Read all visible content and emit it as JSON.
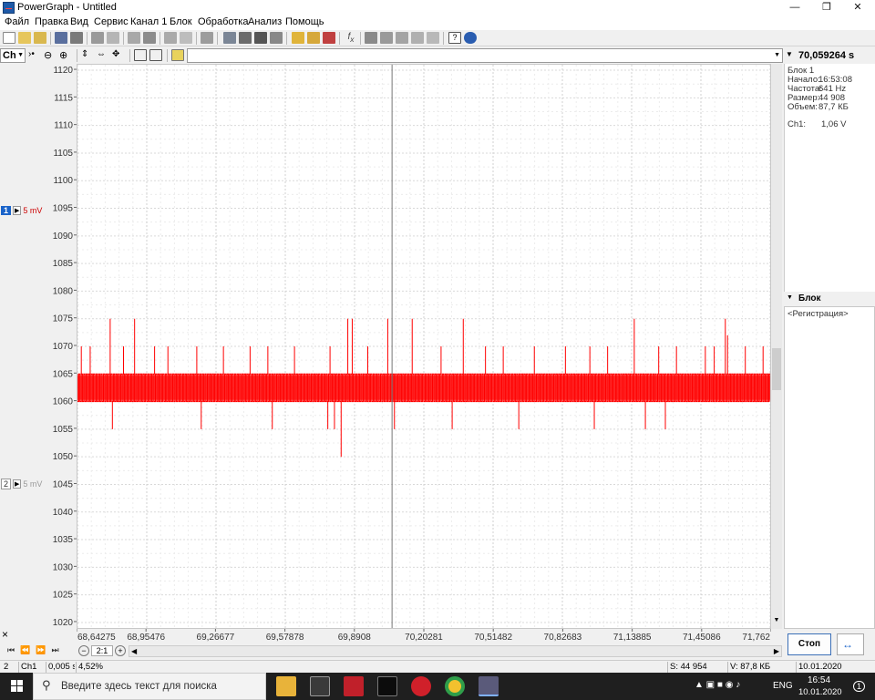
{
  "window": {
    "title": "PowerGraph - Untitled"
  },
  "menu": [
    "Файл",
    "Правка",
    "Вид",
    "Сервис",
    "Канал 1",
    "Блок",
    "Обработка",
    "Анализ",
    "Помощь"
  ],
  "toolbar2": {
    "channel_select": "Ch",
    "time_readout": "70,059264 s"
  },
  "channels": [
    {
      "number": "1",
      "scale": "5 mV",
      "color": "#cc0000",
      "active": true
    },
    {
      "number": "2",
      "scale": "5 mV",
      "color": "#9a9a9a",
      "active": false
    }
  ],
  "info_panel": {
    "block": "Блок 1",
    "start_label": "Начало:",
    "start_value": "16:53:08",
    "freq_label": "Частота:",
    "freq_value": "641 Hz",
    "size_label": "Размер:",
    "size_value": "44 908",
    "volume_label": "Объем:",
    "volume_value": "87,7 КБ",
    "ch1_label": "Ch1:",
    "ch1_value": "1,06 V"
  },
  "block_panel": {
    "header": "Блок",
    "item": "<Регистрация>"
  },
  "controls": {
    "close_glyph": "×",
    "zoom_ratio": "2:1",
    "stop_label": "Стоп"
  },
  "status": {
    "index": "2",
    "channel": "Ch1",
    "dt": "0,005 s",
    "percent": "4,52%",
    "samples": "S: 44 954",
    "volume": "V: 87,8 КБ",
    "date": "10.01.2020"
  },
  "taskbar": {
    "search_placeholder": "Введите здесь текст для поиска",
    "lang": "ENG",
    "time": "16:54",
    "date": "10.01.2020",
    "notifications": "1"
  },
  "chart_data": {
    "type": "line",
    "y_ticks": [
      1120,
      1115,
      1110,
      1105,
      1100,
      1095,
      1090,
      1085,
      1080,
      1075,
      1070,
      1065,
      1060,
      1055,
      1050,
      1045,
      1040,
      1035,
      1030,
      1025,
      1020
    ],
    "ylim": [
      1019,
      1121
    ],
    "x_ticks": [
      "68,64275",
      "68,95476",
      "69,26677",
      "69,57878",
      "69,8908",
      "70,20281",
      "70,51482",
      "70,82683",
      "71,13885",
      "71,45086",
      "71,762"
    ],
    "xlim": [
      68.64275,
      71.762
    ],
    "cursor_x": 70.059264,
    "grid": true,
    "series": [
      {
        "color": "#ff0000",
        "band_low": 1060,
        "band_high": 1065,
        "spike_up": [
          {
            "x": 68.66,
            "y": 1070
          },
          {
            "x": 68.7,
            "y": 1070
          },
          {
            "x": 68.79,
            "y": 1075
          },
          {
            "x": 68.85,
            "y": 1070
          },
          {
            "x": 68.9,
            "y": 1075
          },
          {
            "x": 68.99,
            "y": 1070
          },
          {
            "x": 69.05,
            "y": 1070
          },
          {
            "x": 69.18,
            "y": 1070
          },
          {
            "x": 69.3,
            "y": 1070
          },
          {
            "x": 69.42,
            "y": 1070
          },
          {
            "x": 69.5,
            "y": 1070
          },
          {
            "x": 69.62,
            "y": 1070
          },
          {
            "x": 69.78,
            "y": 1070
          },
          {
            "x": 69.86,
            "y": 1075
          },
          {
            "x": 69.88,
            "y": 1075
          },
          {
            "x": 69.95,
            "y": 1070
          },
          {
            "x": 70.04,
            "y": 1075
          },
          {
            "x": 70.15,
            "y": 1075
          },
          {
            "x": 70.28,
            "y": 1070
          },
          {
            "x": 70.38,
            "y": 1075
          },
          {
            "x": 70.48,
            "y": 1070
          },
          {
            "x": 70.56,
            "y": 1070
          },
          {
            "x": 70.7,
            "y": 1070
          },
          {
            "x": 70.84,
            "y": 1070
          },
          {
            "x": 70.95,
            "y": 1070
          },
          {
            "x": 71.03,
            "y": 1070
          },
          {
            "x": 71.15,
            "y": 1075
          },
          {
            "x": 71.26,
            "y": 1070
          },
          {
            "x": 71.34,
            "y": 1070
          },
          {
            "x": 71.47,
            "y": 1070
          },
          {
            "x": 71.51,
            "y": 1070
          },
          {
            "x": 71.56,
            "y": 1075
          },
          {
            "x": 71.57,
            "y": 1072
          },
          {
            "x": 71.65,
            "y": 1070
          },
          {
            "x": 71.73,
            "y": 1070
          }
        ],
        "spike_down": [
          {
            "x": 68.8,
            "y": 1055
          },
          {
            "x": 69.2,
            "y": 1055
          },
          {
            "x": 69.52,
            "y": 1055
          },
          {
            "x": 69.77,
            "y": 1055
          },
          {
            "x": 69.8,
            "y": 1055
          },
          {
            "x": 69.83,
            "y": 1050
          },
          {
            "x": 70.07,
            "y": 1055
          },
          {
            "x": 70.33,
            "y": 1055
          },
          {
            "x": 70.63,
            "y": 1055
          },
          {
            "x": 70.97,
            "y": 1055
          },
          {
            "x": 71.2,
            "y": 1055
          },
          {
            "x": 71.29,
            "y": 1055
          }
        ]
      }
    ]
  }
}
